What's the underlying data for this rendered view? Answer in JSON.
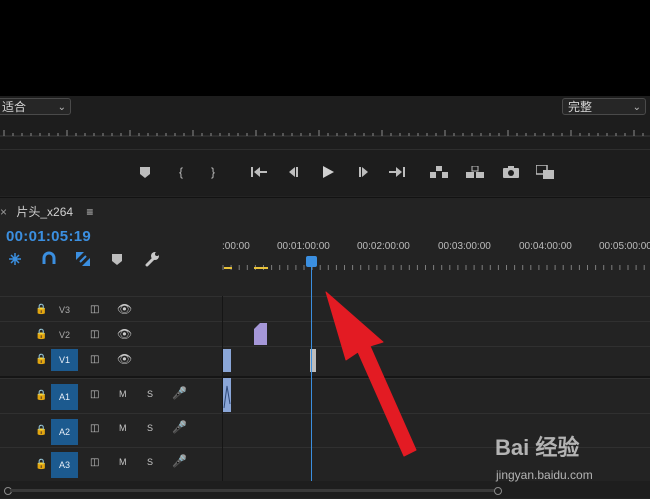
{
  "monitor": {
    "fit_label": "适合",
    "quality_label": "完整"
  },
  "sequence": {
    "tab_label": "片头_x264",
    "timecode": "00:01:05:19"
  },
  "ruler": {
    "labels": [
      ":00:00",
      "00:01:00:00",
      "00:02:00:00",
      "00:03:00:00",
      "00:04:00:00",
      "00:05:00:00"
    ]
  },
  "tracks": {
    "video": [
      {
        "label": "V3",
        "targeted": false
      },
      {
        "label": "V2",
        "targeted": false
      },
      {
        "label": "V1",
        "targeted": true
      }
    ],
    "audio": [
      {
        "label": "A1",
        "m": "M",
        "s": "S",
        "targeted": true
      },
      {
        "label": "A2",
        "m": "M",
        "s": "S",
        "targeted": true
      },
      {
        "label": "A3",
        "m": "M",
        "s": "S",
        "targeted": true
      }
    ]
  },
  "watermark": {
    "brand": "Bai 经验",
    "url": "jingyan.baidu.com"
  },
  "colors": {
    "accent": "#3b8fe0",
    "arrow": "#e31b23",
    "clip_purple": "#a597d8",
    "clip_blue": "#8aa6d8",
    "marker_yellow": "#e8c23a"
  },
  "icons": [
    "marker-icon",
    "mark-in-icon",
    "mark-out-icon",
    "go-to-in-icon",
    "step-back-icon",
    "play-icon",
    "step-forward-icon",
    "go-to-out-icon",
    "lift-icon",
    "extract-icon",
    "camera-icon",
    "comparison-icon",
    "snap-icon",
    "magnet-icon",
    "linked-selection-icon",
    "add-marker-icon",
    "wrench-icon",
    "lock-icon",
    "toggle-output-icon",
    "eye-icon",
    "mic-icon"
  ]
}
